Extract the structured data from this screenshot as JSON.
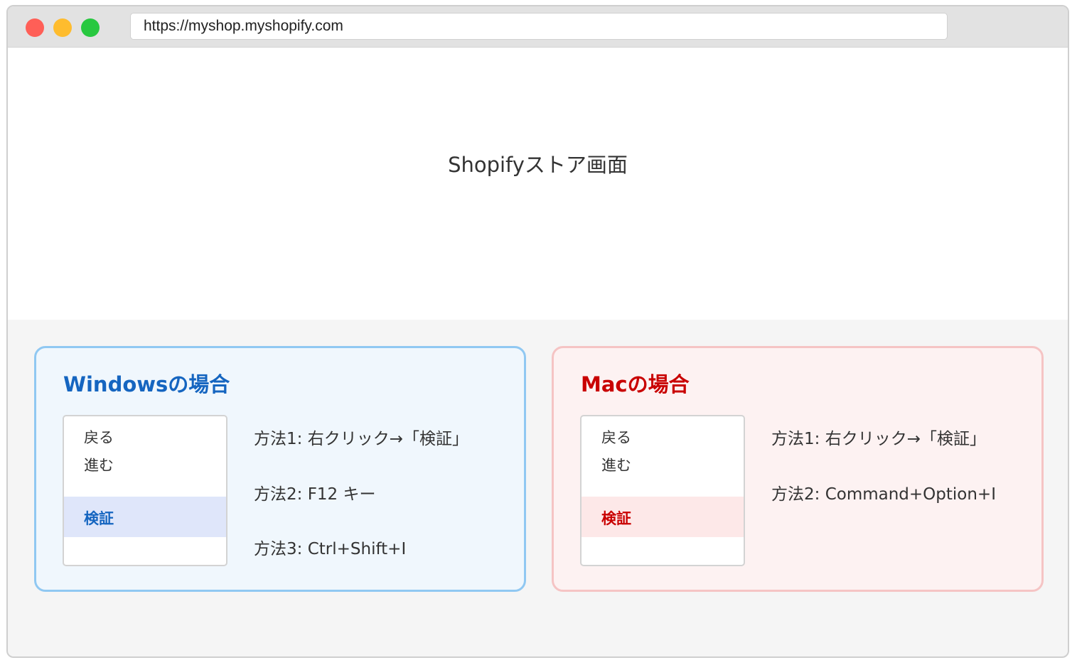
{
  "browser": {
    "url": "https://myshop.myshopify.com"
  },
  "store": {
    "label": "Shopifyストア画面"
  },
  "windows": {
    "title": "Windowsの場合",
    "menu": {
      "back": "戻る",
      "forward": "進む",
      "inspect": "検証"
    },
    "methods": [
      "方法1: 右クリック→「検証」",
      "方法2: F12 キー",
      "方法3: Ctrl+Shift+I"
    ]
  },
  "mac": {
    "title": "Macの場合",
    "menu": {
      "back": "戻る",
      "forward": "進む",
      "inspect": "検証"
    },
    "methods": [
      "方法1: 右クリック→「検証」",
      "方法2: Command+Option+I"
    ]
  },
  "colors": {
    "windows_accent": "#1565c0",
    "mac_accent": "#c90000"
  }
}
